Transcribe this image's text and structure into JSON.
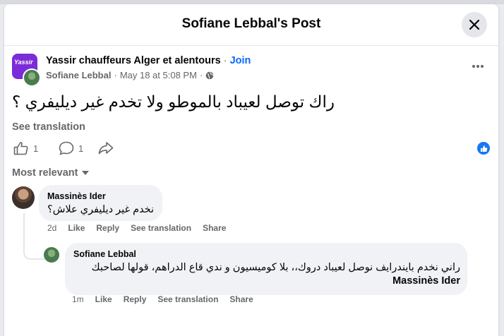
{
  "modal": {
    "title": "Sofiane Lebbal's Post",
    "close_icon": "close-icon"
  },
  "post": {
    "group_name": "Yassir chauffeurs Alger et alentours",
    "separator": "·",
    "join_label": "Join",
    "group_avatar_text": "Yassir",
    "author": "Sofiane Lebbal",
    "timestamp": "May 18 at 5:08 PM",
    "privacy_icon": "globe-icon",
    "text": "راك توصل لعيباد بالموطو ولا تخدم غير ديليفري ؟",
    "see_translation": "See translation",
    "like_count": "1",
    "comment_count": "1",
    "reaction_icon": "like-reaction-icon"
  },
  "comments_header": {
    "sort_label": "Most relevant"
  },
  "comments": [
    {
      "name": "Massinès Ider",
      "text": "نخدم غير ديليفري علاش؟",
      "time": "2d",
      "like": "Like",
      "reply": "Reply",
      "see_translation": "See translation",
      "share": "Share"
    },
    {
      "name": "Sofiane Lebbal",
      "mention": "Massinès Ider",
      "text": "راني نخدم بايندرايف نوصل لعيباد دروك،، بلا كوميسيون و ندي قاع الدراهم، قولها لصاحبك",
      "time": "1m",
      "like": "Like",
      "reply": "Reply",
      "see_translation": "See translation",
      "share": "Share"
    }
  ],
  "colors": {
    "accent": "#0866ff",
    "group_avatar": "#7b2bd8",
    "bubble": "#f0f2f5",
    "muted_text": "#65676b"
  }
}
